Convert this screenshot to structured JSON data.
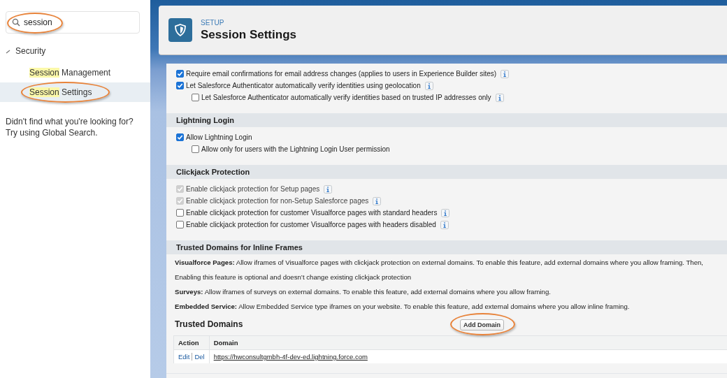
{
  "sidebar": {
    "search": {
      "value": "session"
    },
    "tree": [
      {
        "label": "Security",
        "expanded": true,
        "children": [
          {
            "match": "Session",
            "text": " Management",
            "selected": false
          },
          {
            "match": "Session",
            "text": " Settings",
            "selected": true
          }
        ]
      }
    ],
    "hint": [
      "Didn't find what you're looking for?",
      "Try using Global Search."
    ]
  },
  "header": {
    "eyebrow": "SETUP",
    "title": "Session Settings"
  },
  "sections": [
    {
      "items": [
        {
          "label": "Require email confirmations for email address changes (applies to users in Experience Builder sites)",
          "checked": true,
          "disabled": false,
          "info": true
        },
        {
          "label": "Let Salesforce Authenticator automatically verify identities using geolocation",
          "checked": true,
          "disabled": false,
          "info": true,
          "children": [
            {
              "label": "Let Salesforce Authenticator automatically verify identities based on trusted IP addresses only",
              "checked": false,
              "disabled": false,
              "info": true
            }
          ]
        }
      ]
    },
    {
      "title": "Lightning Login",
      "items": [
        {
          "label": "Allow Lightning Login",
          "checked": true,
          "disabled": false,
          "info": false,
          "children": [
            {
              "label": "Allow only for users with the Lightning Login User permission",
              "checked": false,
              "disabled": false,
              "info": false
            }
          ]
        }
      ]
    },
    {
      "title": "Clickjack Protection",
      "items": [
        {
          "label": "Enable clickjack protection for Setup pages",
          "checked": true,
          "disabled": true,
          "info": true
        },
        {
          "label": "Enable clickjack protection for non-Setup Salesforce pages",
          "checked": true,
          "disabled": true,
          "info": true
        },
        {
          "label": "Enable clickjack protection for customer Visualforce pages with standard headers",
          "checked": false,
          "disabled": false,
          "info": true
        },
        {
          "label": "Enable clickjack protection for customer Visualforce pages with headers disabled",
          "checked": false,
          "disabled": false,
          "info": true
        }
      ]
    },
    {
      "title": "Trusted Domains for Inline Frames",
      "paragraphs": [
        "**Visualforce Pages:** Allow iframes of Visualforce pages with clickjack protection on external domains. To enable this feature, add external domains where you allow framing. Then,",
        "Enabling this feature is optional and doesn’t change existing clickjack protection",
        "**Surveys:** Allow iframes of surveys on external domains. To enable this feature, add external domains where you allow framing.",
        "**Embedded Service:** Allow Embedded Service type iframes on your website. To enable this feature, add external domains where you allow inline framing."
      ],
      "trusted": {
        "title": "Trusted Domains",
        "button": "Add Domain",
        "columns": [
          "Action",
          "Domain"
        ],
        "rows": [
          {
            "actions": [
              "Edit",
              "Del"
            ],
            "domain": "https://hwconsultgmbh-4f-dev-ed.lightning.force.com"
          }
        ]
      }
    }
  ]
}
